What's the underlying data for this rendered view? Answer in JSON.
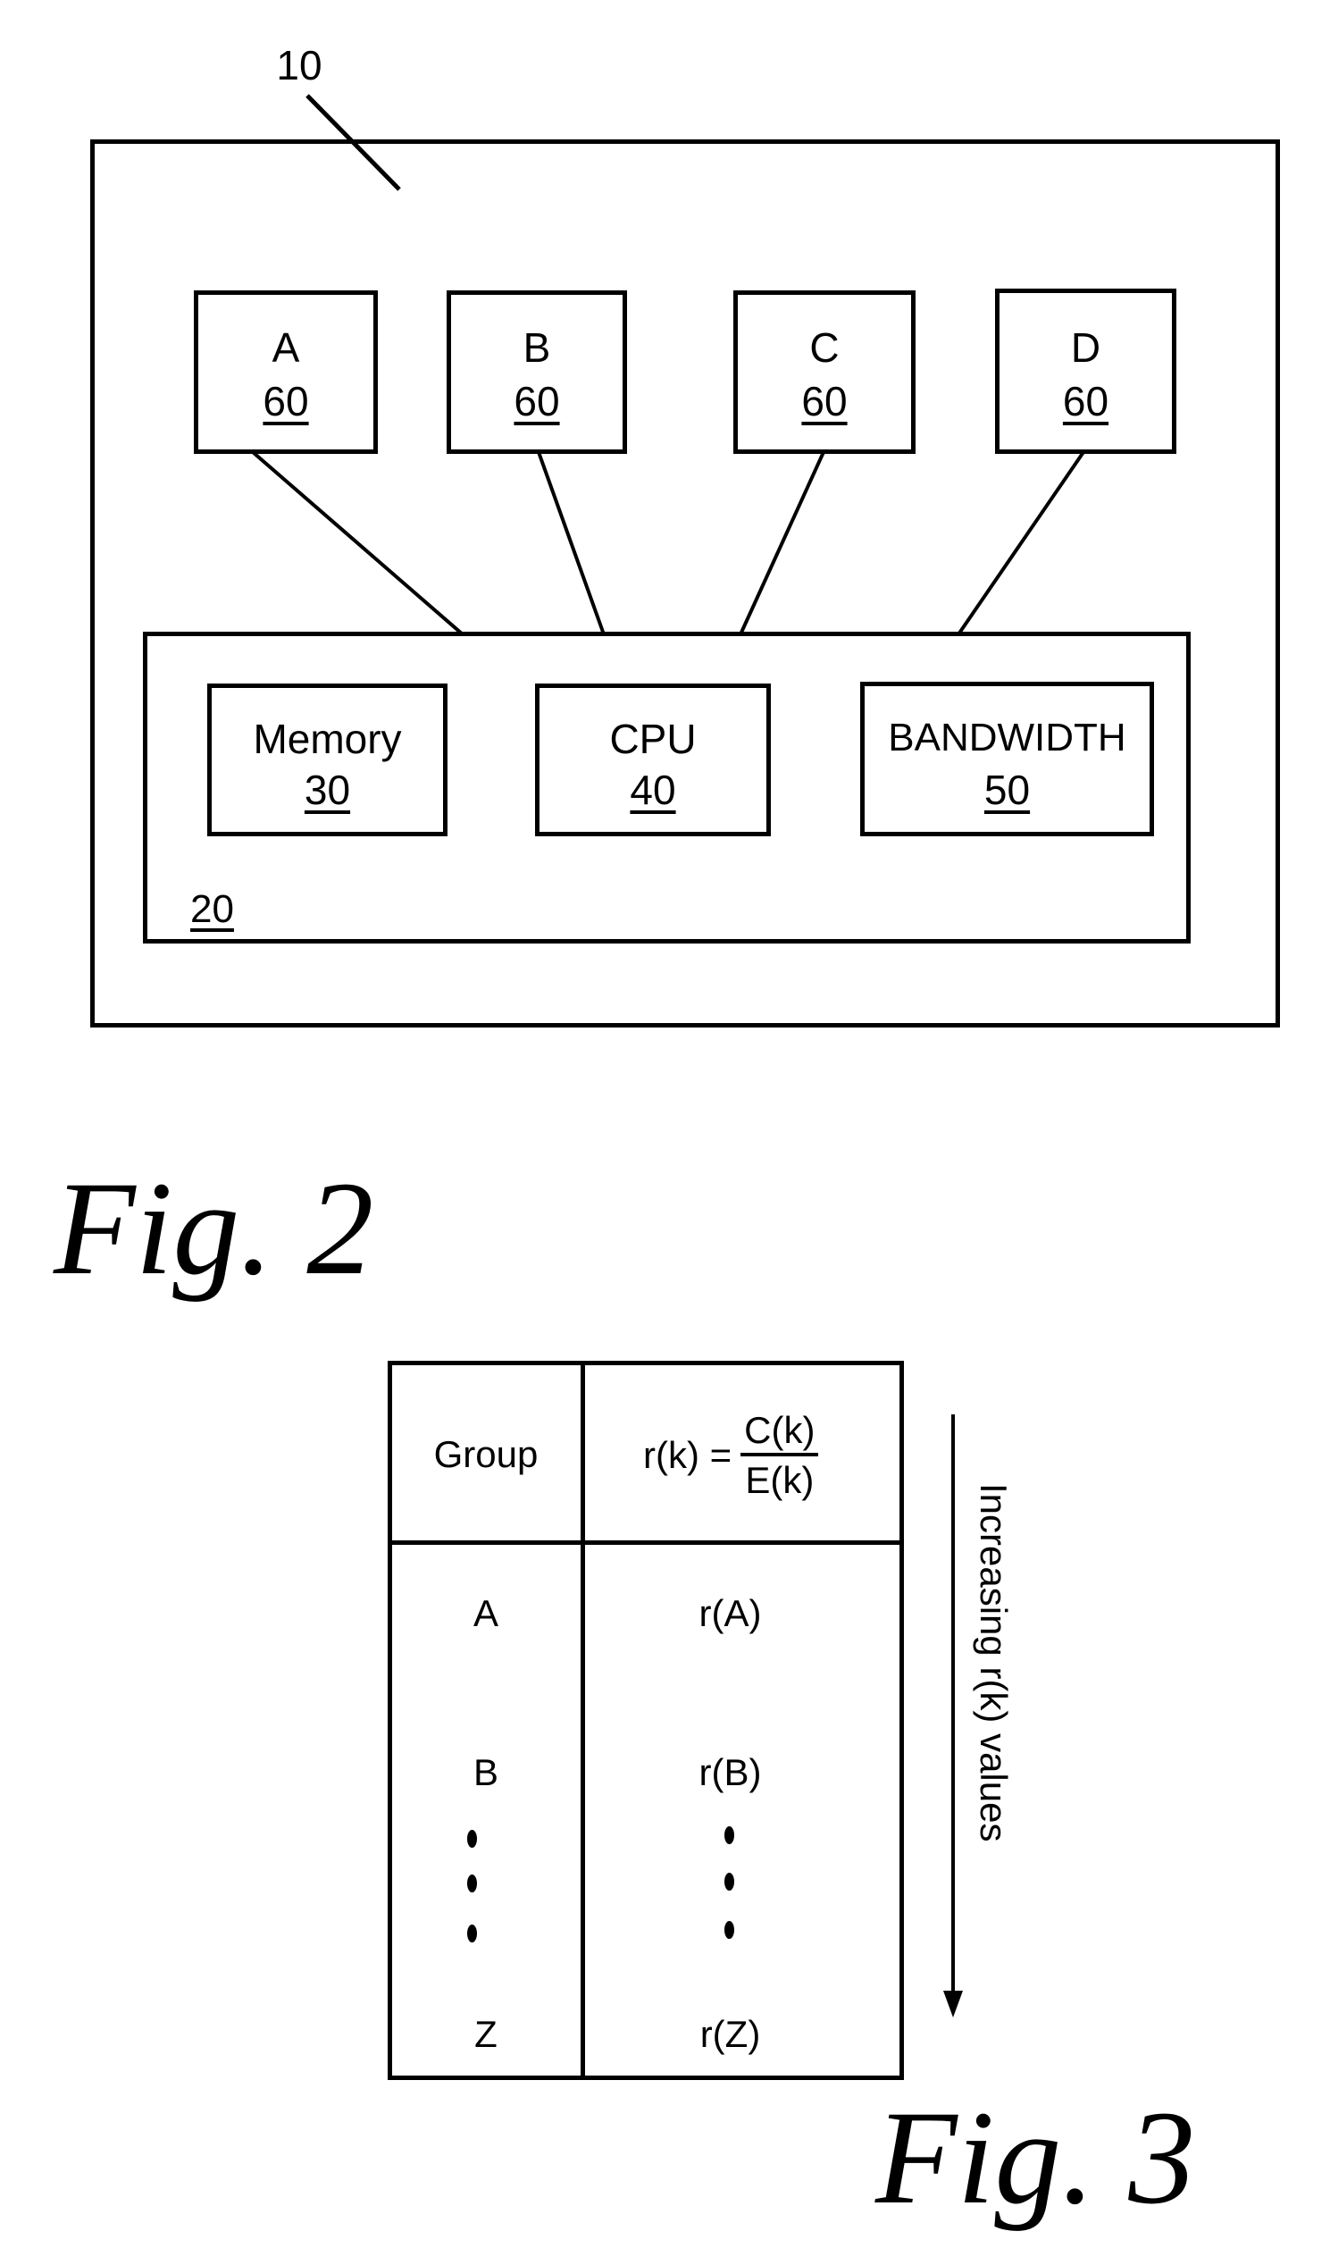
{
  "figure2": {
    "caption": "Fig. 2",
    "system_ref": "10",
    "resource_pool_ref": "20",
    "groups": [
      {
        "label": "A",
        "ref": "60"
      },
      {
        "label": "B",
        "ref": "60"
      },
      {
        "label": "C",
        "ref": "60"
      },
      {
        "label": "D",
        "ref": "60"
      }
    ],
    "resources": [
      {
        "label": "Memory",
        "ref": "30"
      },
      {
        "label": "CPU",
        "ref": "40"
      },
      {
        "label": "BANDWIDTH",
        "ref": "50"
      }
    ]
  },
  "figure3": {
    "caption": "Fig. 3",
    "table": {
      "headers": {
        "group": "Group",
        "formula_lhs": "r(k) =",
        "formula_numerator": "C(k)",
        "formula_denominator": "E(k)"
      },
      "rows": [
        {
          "group": "A",
          "value": "r(A)"
        },
        {
          "group": "B",
          "value": "r(B)"
        },
        {
          "group": "Z",
          "value": "r(Z)"
        }
      ],
      "ellipsis": "⋮"
    },
    "arrow_label": "Increasing r(k) values"
  }
}
